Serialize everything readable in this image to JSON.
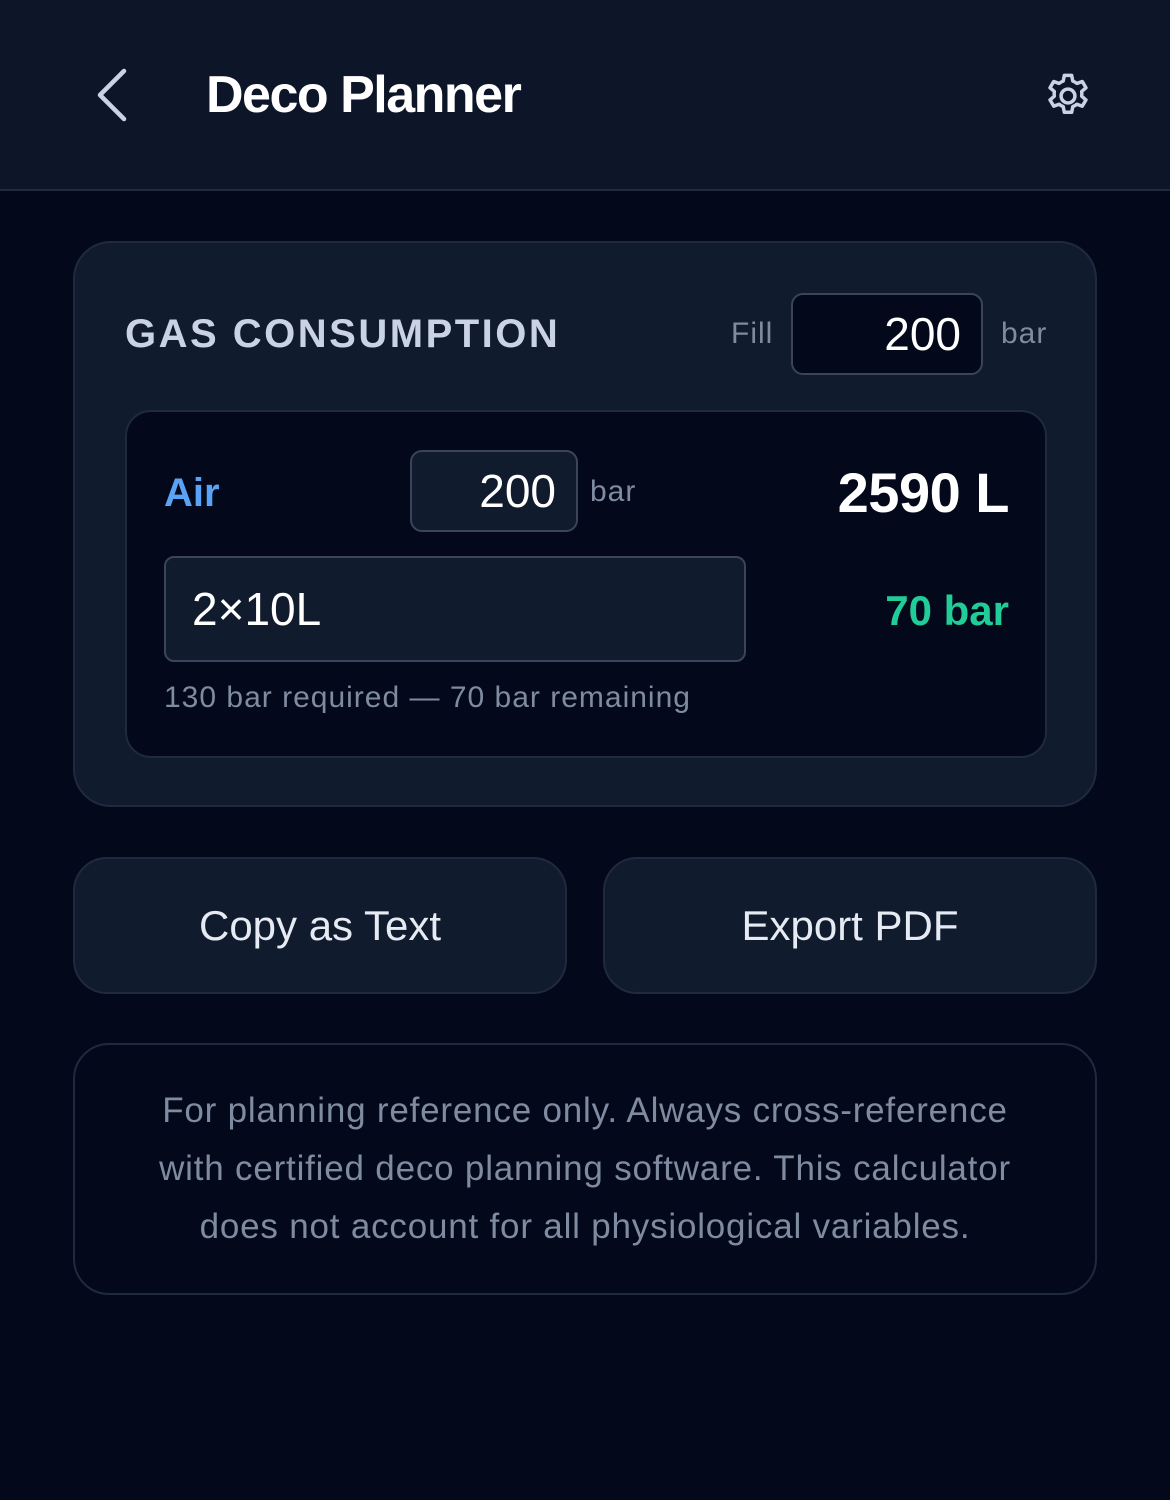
{
  "header": {
    "back_icon": "chevron-left-icon",
    "title": "Deco Planner",
    "settings_icon": "gear-icon"
  },
  "gas_consumption": {
    "title": "GAS CONSUMPTION",
    "fill_label": "Fill",
    "fill_value": "200",
    "fill_unit": "bar",
    "gases": [
      {
        "name": "Air",
        "pressure_value": "200",
        "pressure_unit": "bar",
        "volume": "2590 L",
        "cylinder": "2×10L",
        "remaining": "70 bar",
        "note": "130 bar required — 70 bar remaining"
      }
    ]
  },
  "actions": {
    "copy_label": "Copy as Text",
    "export_label": "Export PDF"
  },
  "disclaimer": {
    "text": "For planning reference only. Always cross-reference with certified deco planning software. This calculator does not account for all physiological variables."
  },
  "colors": {
    "background": "#03091a",
    "surface": "#111b2e",
    "accent_gas": "#5aa2f5",
    "success": "#22cc99",
    "muted": "#7f8ba0"
  }
}
